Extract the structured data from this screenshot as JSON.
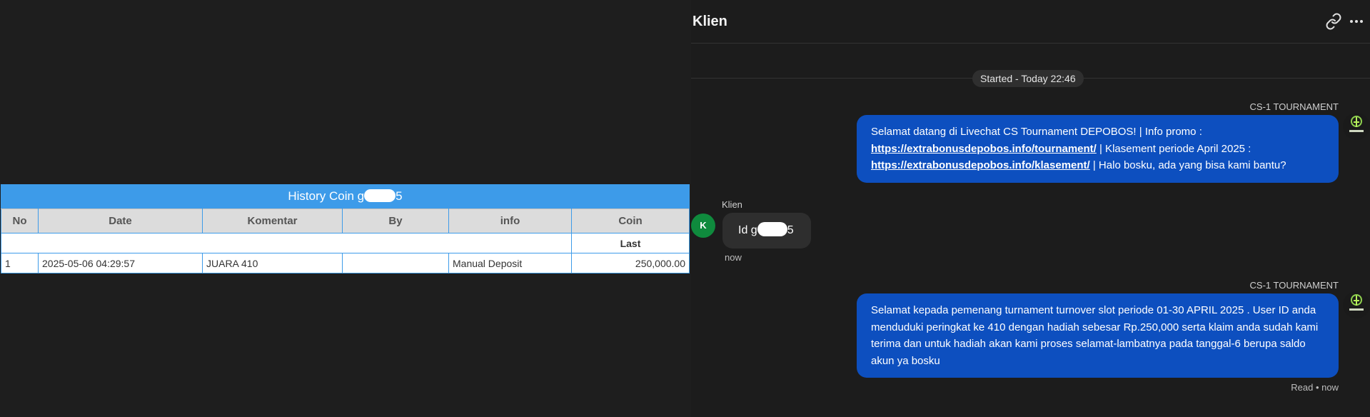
{
  "history": {
    "title_prefix": "History Coin g",
    "title_suffix": "5",
    "columns": [
      "No",
      "Date",
      "Komentar",
      "By",
      "info",
      "Coin"
    ],
    "sub_header": "Last",
    "rows": [
      {
        "no": "1",
        "date": "2025-05-06 04:29:57",
        "komentar": "JUARA 410",
        "by": "",
        "info": "Manual Deposit",
        "coin": "250,000.00"
      }
    ]
  },
  "chat": {
    "title": "Klien",
    "started": "Started - Today 22:46",
    "messages": {
      "agent1": {
        "sender": "CS-1 TOURNAMENT",
        "t1": "Selamat datang di Livechat CS Tournament DEPOBOS! | Info promo :",
        "link1": "https://extrabonusdepobos.info/tournament/",
        "t2": " | Klasement periode April 2025 :",
        "link2": "https://extrabonusdepobos.info/klasement/",
        "t3": " | Halo bosku, ada yang bisa kami bantu?"
      },
      "client1": {
        "sender": "Klien",
        "avatar_letter": "K",
        "prefix": "Id g",
        "suffix": "5",
        "time": "now"
      },
      "agent2": {
        "sender": "CS-1 TOURNAMENT",
        "text": "Selamat kepada pemenang turnament turnover slot periode 01-30 APRIL 2025 . User ID anda menduduki peringkat ke 410 dengan hadiah sebesar Rp.250,000 serta klaim anda sudah kami terima dan untuk hadiah akan kami proses selamat-lambatnya pada tanggal-6 berupa saldo akun ya bosku"
      }
    },
    "read_status": "Read • now"
  },
  "icons": {
    "header_link": "link-icon",
    "header_more": "more-horizontal-icon",
    "agent_avatar": "depobos-logo-icon"
  },
  "colors": {
    "agent_bubble": "#0d4fbf",
    "table_header": "#3d9be9",
    "coin_value": "#1f8a1f",
    "client_avatar": "#0f8a3d"
  }
}
